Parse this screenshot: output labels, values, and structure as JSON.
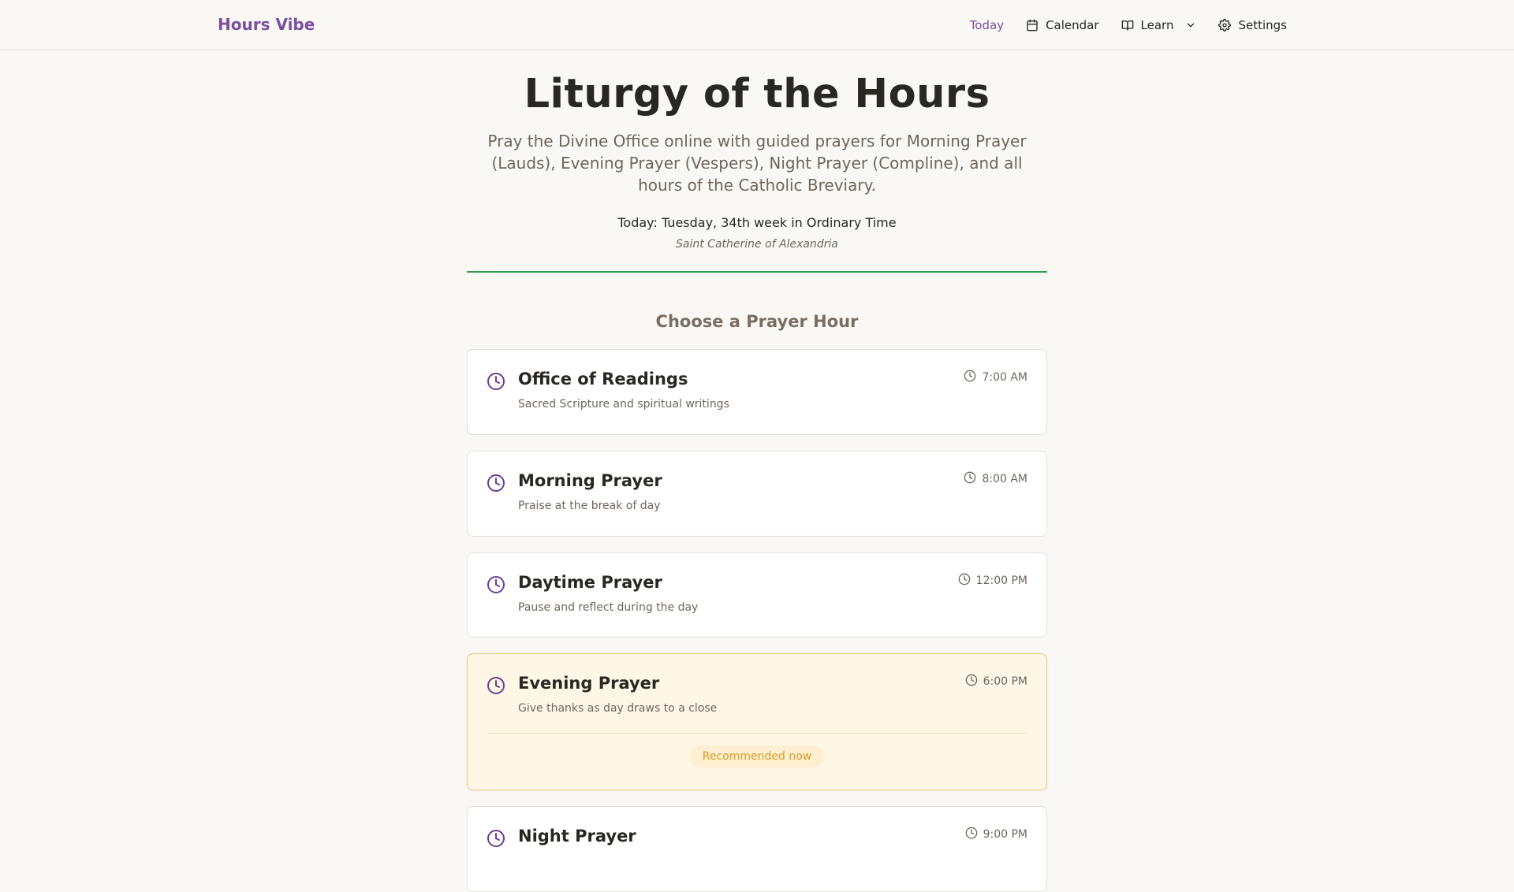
{
  "header": {
    "brand": "Hours Vibe",
    "nav": {
      "today": "Today",
      "calendar": "Calendar",
      "learn": "Learn",
      "settings": "Settings"
    }
  },
  "hero": {
    "title": "Liturgy of the Hours",
    "subtitle": "Pray the Divine Office online with guided prayers for Morning Prayer (Lauds), Evening Prayer (Vespers), Night Prayer (Compline), and all hours of the Catholic Breviary.",
    "today": "Today: Tuesday, 34th week in Ordinary Time",
    "saint": "Saint Catherine of Alexandria"
  },
  "section": {
    "title": "Choose a Prayer Hour"
  },
  "hours": [
    {
      "title": "Office of Readings",
      "desc": "Sacred Scripture and spiritual writings",
      "time": "7:00 AM"
    },
    {
      "title": "Morning Prayer",
      "desc": "Praise at the break of day",
      "time": "8:00 AM"
    },
    {
      "title": "Daytime Prayer",
      "desc": "Pause and reflect during the day",
      "time": "12:00 PM"
    },
    {
      "title": "Evening Prayer",
      "desc": "Give thanks as day draws to a close",
      "time": "6:00 PM",
      "badge": "Recommended now"
    },
    {
      "title": "Night Prayer",
      "desc": "",
      "time": "9:00 PM"
    }
  ],
  "colors": {
    "brand": "#7a4fa0",
    "divider": "#2f9a52",
    "recommended_bg": "#fff7e6",
    "recommended_border": "#ebc780",
    "badge_text": "#d99c2b"
  },
  "icons": {
    "calendar": "calendar-icon",
    "learn": "book-open-icon",
    "learn_dropdown": "chevron-down-icon",
    "settings": "gear-icon",
    "hour": "clock-icon"
  }
}
